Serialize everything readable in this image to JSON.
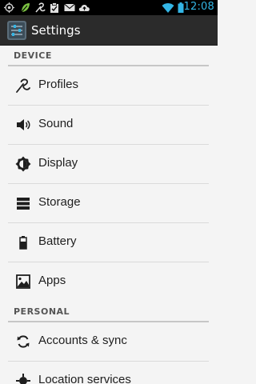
{
  "status_bar": {
    "time": "12:08",
    "icons": [
      "signal-indicator-icon",
      "leaf-icon",
      "profile-mode-icon",
      "clipboard-icon",
      "email-icon",
      "cloud-upload-icon",
      "wifi-icon",
      "battery-icon"
    ],
    "accent_color": "#33b5e5"
  },
  "action_bar": {
    "title": "Settings",
    "icon": "settings-app-icon"
  },
  "sections": {
    "device": {
      "label": "DEVICE",
      "items": [
        {
          "label": "Profiles",
          "icon": "profiles-icon"
        },
        {
          "label": "Sound",
          "icon": "speaker-icon"
        },
        {
          "label": "Display",
          "icon": "brightness-icon"
        },
        {
          "label": "Storage",
          "icon": "storage-icon"
        },
        {
          "label": "Battery",
          "icon": "battery-icon"
        },
        {
          "label": "Apps",
          "icon": "apps-icon"
        }
      ]
    },
    "personal": {
      "label": "PERSONAL",
      "items": [
        {
          "label": "Accounts & sync",
          "icon": "sync-icon"
        },
        {
          "label": "Location services",
          "icon": "location-icon"
        }
      ]
    }
  }
}
